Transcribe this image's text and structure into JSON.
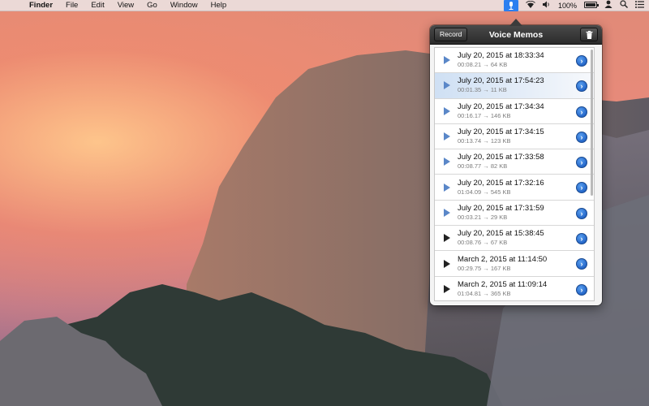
{
  "menubar": {
    "apple_icon": "apple-icon",
    "items": [
      "Finder",
      "File",
      "Edit",
      "View",
      "Go",
      "Window",
      "Help"
    ],
    "status": {
      "battery_text": "100%"
    }
  },
  "popover": {
    "title": "Voice Memos",
    "record_label": "Record",
    "memos": [
      {
        "date": "July 20, 2015 at 18:33:34",
        "duration": "00:08.21",
        "size": "64 KB",
        "played": false,
        "selected": false
      },
      {
        "date": "July 20, 2015 at 17:54:23",
        "duration": "00:01.35",
        "size": "11 KB",
        "played": false,
        "selected": true
      },
      {
        "date": "July 20, 2015 at 17:34:34",
        "duration": "00:16.17",
        "size": "146 KB",
        "played": false,
        "selected": false
      },
      {
        "date": "July 20, 2015 at 17:34:15",
        "duration": "00:13.74",
        "size": "123 KB",
        "played": false,
        "selected": false
      },
      {
        "date": "July 20, 2015 at 17:33:58",
        "duration": "00:08.77",
        "size": "82 KB",
        "played": false,
        "selected": false
      },
      {
        "date": "July 20, 2015 at 17:32:16",
        "duration": "01:04.09",
        "size": "545 KB",
        "played": false,
        "selected": false
      },
      {
        "date": "July 20, 2015 at 17:31:59",
        "duration": "00:03.21",
        "size": "29 KB",
        "played": false,
        "selected": false
      },
      {
        "date": "July 20, 2015 at 15:38:45",
        "duration": "00:08.76",
        "size": "67 KB",
        "played": true,
        "selected": false
      },
      {
        "date": "March 2, 2015 at 11:14:50",
        "duration": "00:29.75",
        "size": "167 KB",
        "played": true,
        "selected": false
      },
      {
        "date": "March 2, 2015 at 11:09:14",
        "duration": "01:04.81",
        "size": "365 KB",
        "played": true,
        "selected": false
      }
    ]
  },
  "colors": {
    "accent": "#2c7ff0",
    "play_unplayed": "#5a87c8",
    "play_played": "#222222"
  }
}
